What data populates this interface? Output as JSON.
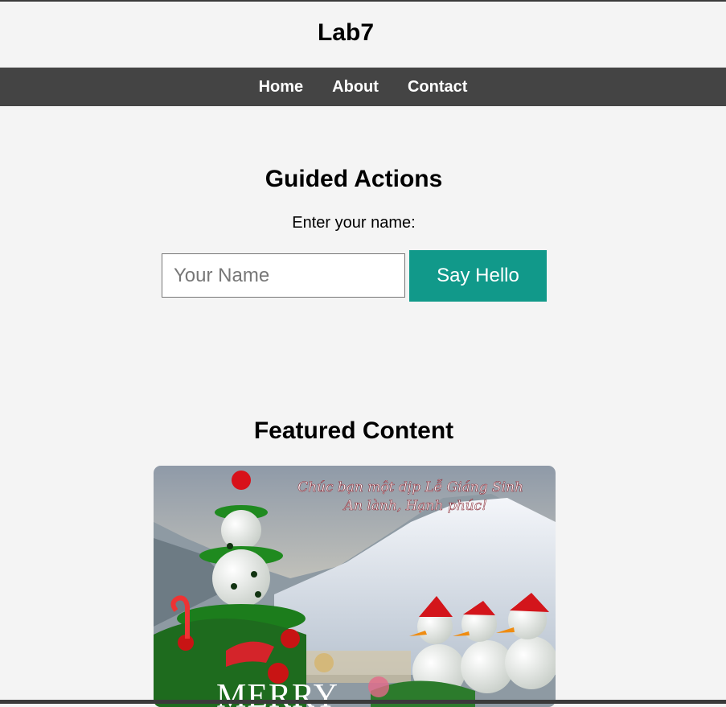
{
  "header": {
    "title": "Lab7"
  },
  "nav": {
    "items": [
      "Home",
      "About",
      "Contact"
    ]
  },
  "guided": {
    "title": "Guided Actions",
    "label": "Enter your name:",
    "input_placeholder": "Your Name",
    "input_value": "",
    "button_label": "Say Hello"
  },
  "featured": {
    "title": "Featured Content",
    "image": {
      "caption_line1": "Chúc bạn một dịp Lễ Giáng Sinh",
      "caption_line2": "An lành, Hạnh phúc!",
      "banner_text": "MERRY"
    }
  },
  "colors": {
    "nav_bg": "#444444",
    "button_bg": "#11998a",
    "page_bg": "#f4f4f4"
  }
}
